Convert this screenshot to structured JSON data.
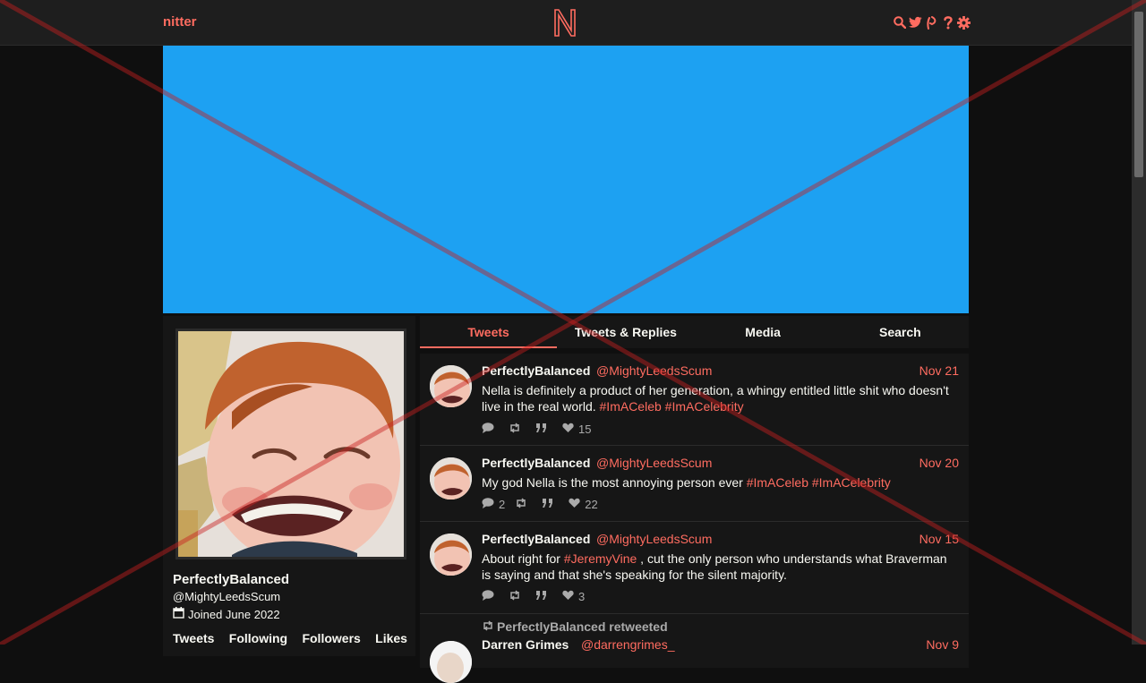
{
  "nav": {
    "brand": "nitter",
    "logo_icon": "nitter-logo-icon",
    "icons": [
      "search-icon",
      "twitter-bird-icon",
      "rss-icon",
      "help-icon",
      "gear-icon"
    ]
  },
  "banner": {
    "color": "#1da1f2"
  },
  "profile": {
    "name": "PerfectlyBalanced",
    "handle": "@MightyLeedsScum",
    "joined": "Joined June 2022",
    "stats": [
      "Tweets",
      "Following",
      "Followers",
      "Likes"
    ]
  },
  "tabs": [
    {
      "label": "Tweets",
      "active": true
    },
    {
      "label": "Tweets & Replies"
    },
    {
      "label": "Media"
    },
    {
      "label": "Search"
    }
  ],
  "tweets": [
    {
      "name": "PerfectlyBalanced",
      "handle": "@MightyLeedsScum",
      "date": "Nov 21",
      "text": "Nella is definitely a product of her generation, a whingy entitled little shit who doesn't live in the real world.",
      "tags": [
        "#ImACeleb",
        "#ImACelebrity"
      ],
      "replies": "",
      "retweets": "",
      "quotes": "",
      "likes": "15"
    },
    {
      "name": "PerfectlyBalanced",
      "handle": "@MightyLeedsScum",
      "date": "Nov 20",
      "text": "My god Nella is the most annoying person ever",
      "tags": [
        "#ImACeleb",
        "#ImACelebrity"
      ],
      "replies": "2",
      "retweets": "",
      "quotes": "",
      "likes": "22"
    },
    {
      "name": "PerfectlyBalanced",
      "handle": "@MightyLeedsScum",
      "date": "Nov 15",
      "text_before": "About right for",
      "tag": "#JeremyVine",
      "text_after": ", cut the only person who understands what Braverman is saying and that she's speaking for the silent majority.",
      "replies": "",
      "retweets": "",
      "quotes": "",
      "likes": "3"
    },
    {
      "retweet_header": "PerfectlyBalanced retweeted",
      "name": "Darren Grimes",
      "handle": "@darrengrimes_",
      "date": "Nov 9"
    }
  ],
  "colors": {
    "accent": "#ff6c60",
    "background": "#0f0f0f",
    "panel": "#161616",
    "navbar": "#1e1e1e",
    "text": "#f8f8f2",
    "muted": "#aaaaaa"
  }
}
